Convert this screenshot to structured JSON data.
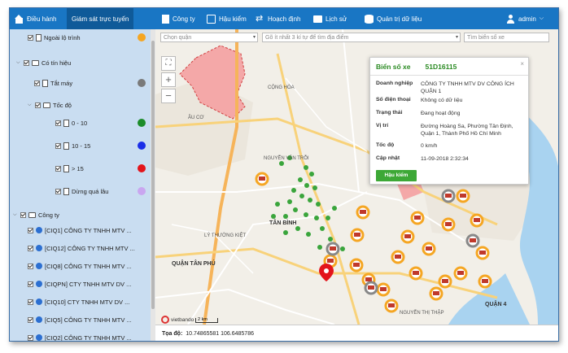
{
  "nav": {
    "items": [
      {
        "label": "Điều hành",
        "icon": "home-icon"
      },
      {
        "label": "Giám sát trực tuyến",
        "icon": "map-icon",
        "active": true
      },
      {
        "label": "Công ty",
        "icon": "building-icon"
      },
      {
        "label": "Hậu kiểm",
        "icon": "clipboard-icon"
      },
      {
        "label": "Hoạch định",
        "icon": "shuffle-icon"
      },
      {
        "label": "Lịch sử",
        "icon": "folder-icon"
      },
      {
        "label": "Quản trị dữ liệu",
        "icon": "database-icon"
      }
    ],
    "user": "admin"
  },
  "sidebar": {
    "route_label": "Ngoài lộ trình",
    "signal_group": "Có tín hiệu",
    "engine_off": "Tắt máy",
    "speed_group": "Tốc độ",
    "speed_items": [
      "0 - 10",
      "10 - 15",
      "> 15"
    ],
    "stopped_long": "Dừng quá lâu",
    "company_group": "Công ty",
    "companies": [
      "[CIQ1] CÔNG TY TNHH MTV ...",
      "[CIQ12] CÔNG TY TNHH MTV ...",
      "[CIQ8] CÔNG TY TNHH MTV ...",
      "[CIQPN] CTY TNHH MTV DV ...",
      "[CIQ10] CTY TNHH MTV DV ...",
      "[CIQ5] CÔNG TY TNHH MTV ...",
      "[CIQ2] CÔNG TY TNHH MTV ..."
    ],
    "colors": {
      "route": "#f5a623",
      "engine_off": "#7a7a7a",
      "slow": "#1c8c2a",
      "mid": "#1a2ee8",
      "fast": "#e3141b",
      "stopped": "#c9a6f0"
    }
  },
  "search": {
    "district_placeholder": "Chọn quận",
    "address_placeholder": "Gõ ít nhất 3 kí tự để tìm địa điểm",
    "plate_placeholder": "Tìm biển số xe"
  },
  "popup": {
    "plate_label": "Biển số xe",
    "plate": "51D16115",
    "rows": [
      {
        "label": "Doanh nghiệp",
        "value": "CÔNG TY TNHH MTV DV CÔNG ÍCH QUẬN 1"
      },
      {
        "label": "Số điện thoại",
        "value": "Không có dữ liệu"
      },
      {
        "label": "Trạng thái",
        "value": "Đang hoạt động"
      },
      {
        "label": "Vị trí",
        "value": "Đường Hoàng Sa, Phường Tân Định, Quận 1, Thành Phố Hồ Chí Minh"
      },
      {
        "label": "Tốc độ",
        "value": "0 km/h"
      },
      {
        "label": "Cập nhật",
        "value": "11-09-2018 2:32:34"
      }
    ],
    "button": "Hậu kiểm"
  },
  "map_labels": {
    "district_tan_binh": "TÂN BÌNH",
    "district_q4": "QUẬN 4",
    "district_tan_phu": "QUẬN TÂN PHÚ",
    "road_nguyen_van_troi": "NGUYỄN VĂN TRỖI",
    "road_cong_hoa": "CỘNG HÒA",
    "road_ly_thuong_kiet": "LÝ THƯỜNG KIỆT",
    "road_nguyen_thi_thap": "NGUYỄN THỊ THẬP",
    "road_au_co": "ÂU CƠ",
    "logo": "vietbando",
    "scale": "2 km"
  },
  "status": {
    "coord_label": "Tọa độ:",
    "coords": "10.74865581 106.6485786"
  }
}
